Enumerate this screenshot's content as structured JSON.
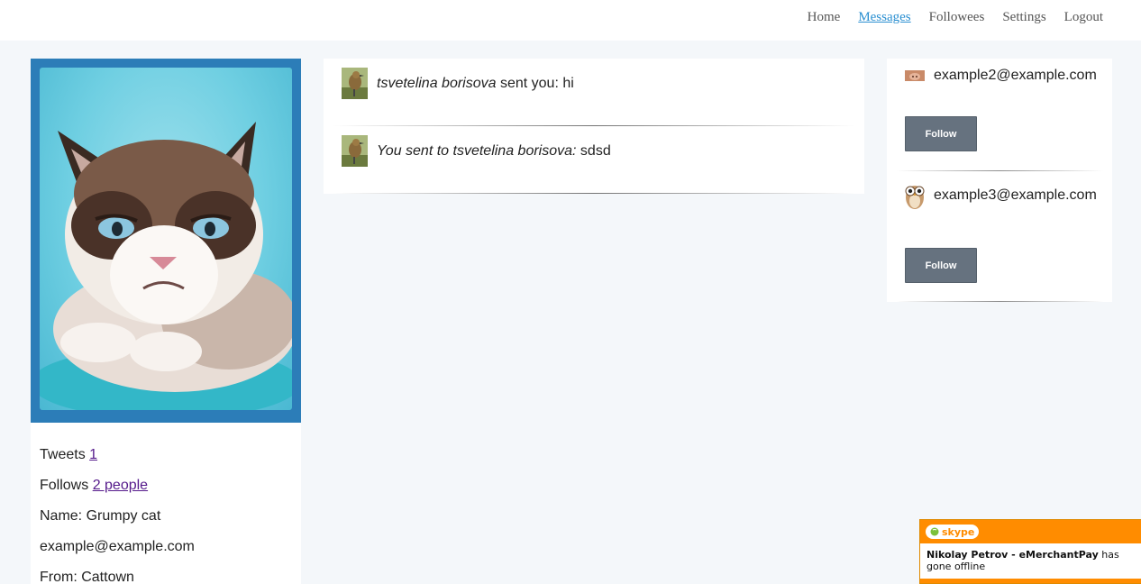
{
  "nav": {
    "items": [
      "Home",
      "Messages",
      "Followees",
      "Settings",
      "Logout"
    ],
    "active": "Messages"
  },
  "profile": {
    "photo_icon": "grumpy-cat-photo",
    "tweets_label": "Tweets",
    "tweets_count": "1",
    "follows_label": "Follows",
    "follows_link": "2 people",
    "name_line": "Name: Grumpy cat",
    "email": "example@example.com",
    "from_line": "From: Cattown"
  },
  "messages": [
    {
      "avatar_icon": "bird-avatar",
      "author": "tsvetelina borisova",
      "verb": " sent you: ",
      "body": "hi"
    },
    {
      "avatar_icon": "bird-avatar",
      "author": "You sent to tsvetelina borisova:",
      "verb": " ",
      "body": "sdsd"
    }
  ],
  "suggestions": [
    {
      "avatar_icon": "pig-avatar",
      "email": "example2@example.com",
      "button": "Follow"
    },
    {
      "avatar_icon": "owl-avatar",
      "email": "example3@example.com",
      "button": "Follow"
    }
  ],
  "skype": {
    "brand": "skype",
    "contact": "Nikolay Petrov - eMerchantPay",
    "status": " has gone offline"
  },
  "colors": {
    "accent_link": "#2a8fd1",
    "profile_frame": "#2c7db8",
    "follow_button": "#66727f",
    "skype_orange": "#ff8c00"
  }
}
